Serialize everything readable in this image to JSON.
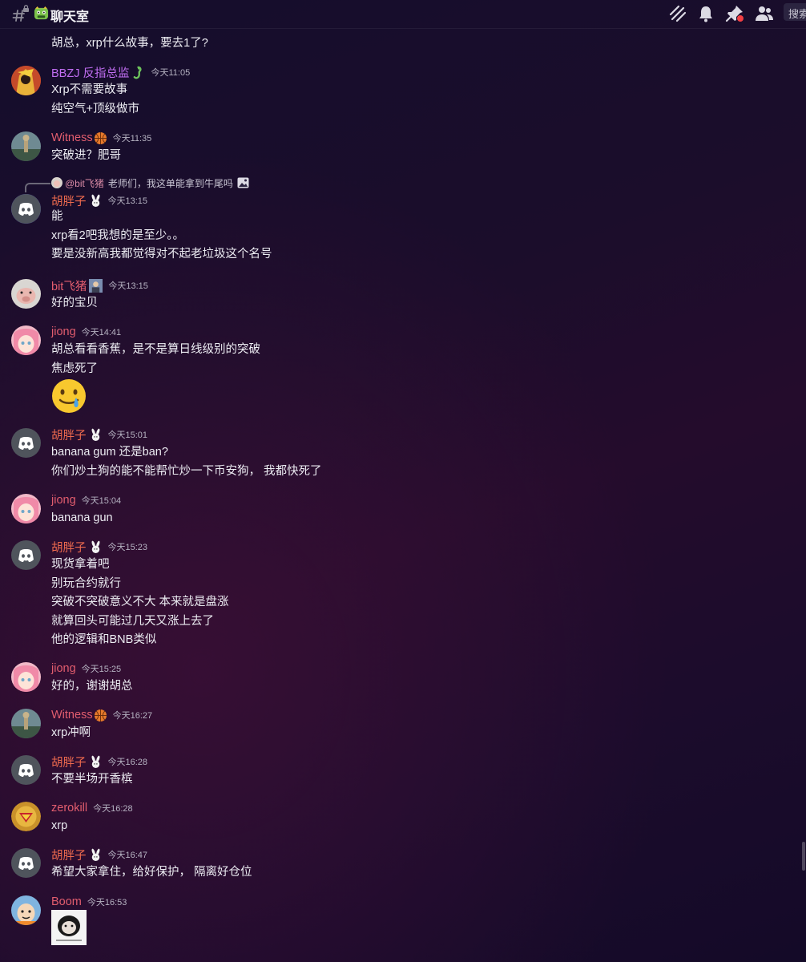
{
  "topbar": {
    "channel_name": "聊天室",
    "search_label": "搜索",
    "icons": [
      "hash-lock-icon",
      "channel-emoji-icon",
      "threads-icon",
      "bell-icon",
      "pin-icon",
      "members-icon"
    ]
  },
  "continuation": {
    "text": "胡总，xrp什么故事，要去1了?"
  },
  "colors": {
    "pink_name": "#e25d6e",
    "purple_name": "#c16ef2",
    "orange_name": "#ee6a4e",
    "discord_blurple": "#5865f2"
  },
  "messages": [
    {
      "user": "BBZJ 反指总监",
      "time": "今天11:05",
      "lines": [
        "Xrp不需要故事",
        "纯空气+顶级做市"
      ]
    },
    {
      "user": "Witness",
      "time": "今天11:35",
      "lines": [
        "突破进？肥哥"
      ]
    },
    {
      "reply_mention": "@bit飞猪",
      "reply_text": "老师们，我这单能拿到牛尾吗",
      "user": "胡胖子",
      "time": "今天13:15",
      "lines": [
        "能",
        "xrp看2吧我想的是至少。。",
        "要是没新高我都觉得对不起老垃圾这个名号"
      ]
    },
    {
      "user": "bit飞猪",
      "time": "今天13:15",
      "lines": [
        "好的宝贝"
      ]
    },
    {
      "user": "jiong",
      "time": "今天14:41",
      "lines": [
        "胡总看看香蕉，是不是算日线级别的突破",
        "焦虑死了"
      ]
    },
    {
      "user": "胡胖子",
      "time": "今天15:01",
      "lines": [
        "banana gum 还是ban?",
        "你们炒土狗的能不能帮忙炒一下币安狗， 我都快死了"
      ]
    },
    {
      "user": "jiong",
      "time": "今天15:04",
      "lines": [
        "banana gun"
      ]
    },
    {
      "user": "胡胖子",
      "time": "今天15:23",
      "lines": [
        "现货拿着吧",
        "别玩合约就行",
        "突破不突破意义不大 本来就是盘涨",
        "就算回头可能过几天又涨上去了",
        "他的逻辑和BNB类似"
      ]
    },
    {
      "user": "jiong",
      "time": "今天15:25",
      "lines": [
        "好的，谢谢胡总"
      ]
    },
    {
      "user": "Witness",
      "time": "今天16:27",
      "lines": [
        "xrp冲啊"
      ]
    },
    {
      "user": "胡胖子",
      "time": "今天16:28",
      "lines": [
        "不要半场开香槟"
      ]
    },
    {
      "user": "zerokill",
      "time": "今天16:28",
      "lines": [
        "xrp"
      ]
    },
    {
      "user": "胡胖子",
      "time": "今天16:47",
      "lines": [
        "希望大家拿住，给好保护， 隔离好仓位"
      ]
    },
    {
      "user": "Boom",
      "time": "今天16:53",
      "lines": []
    }
  ]
}
